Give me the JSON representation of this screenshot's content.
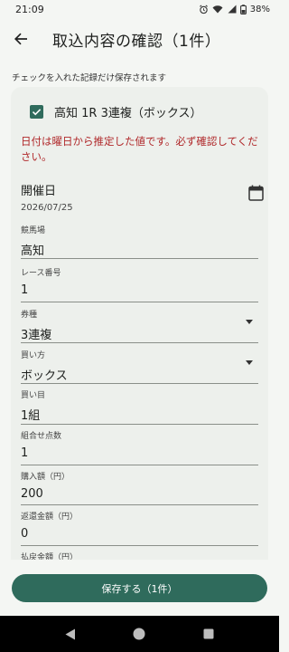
{
  "status_bar": {
    "time": "21:09",
    "battery": "38%"
  },
  "app_bar": {
    "title": "取込内容の確認（1件）"
  },
  "hint": "チェックを入れた記録だけ保存されます",
  "record": {
    "title": "高知 1R  3連複（ボックス）",
    "checked": true,
    "warning": "日付は曜日から推定した値です。必ず確認してください。",
    "date_label": "開催日",
    "date_value": "2026/07/25",
    "fields": [
      {
        "label": "競馬場",
        "value": "高知"
      },
      {
        "label": "レース番号",
        "value": "1"
      },
      {
        "label": "券種",
        "value": "3連複"
      },
      {
        "label": "買い方",
        "value": "ボックス"
      },
      {
        "label": "買い目",
        "value": "1組"
      },
      {
        "label": "組合せ点数",
        "value": "1"
      },
      {
        "label": "購入額（円）",
        "value": "200"
      },
      {
        "label": "返還金額（円）",
        "value": "0"
      },
      {
        "label": "払戻金額（円）",
        "value": ""
      }
    ]
  },
  "save_button": "保存する（1件）",
  "colors": {
    "accent": "#2f6b5c",
    "warning": "#b0282a",
    "background": "#f4f6f3",
    "card": "#edf0ec"
  }
}
